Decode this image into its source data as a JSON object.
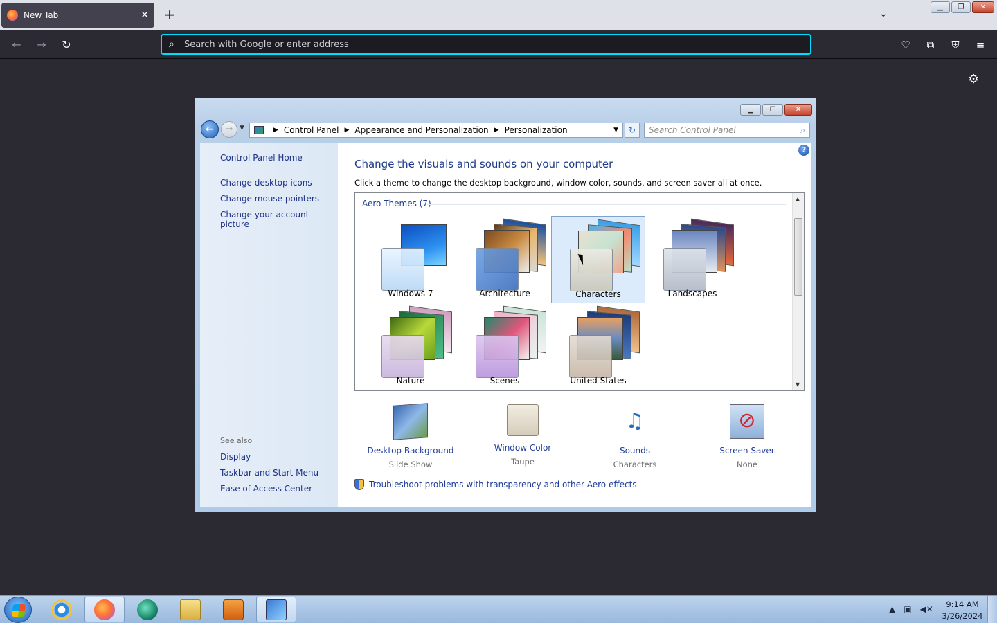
{
  "browser": {
    "tab_title": "New Tab",
    "url_placeholder": "Search with Google or enter address"
  },
  "control_panel": {
    "breadcrumb": [
      "Control Panel",
      "Appearance and Personalization",
      "Personalization"
    ],
    "search_placeholder": "Search Control Panel",
    "left_links": [
      "Control Panel Home",
      "Change desktop icons",
      "Change mouse pointers",
      "Change your account picture"
    ],
    "see_also_label": "See also",
    "see_also_links": [
      "Display",
      "Taskbar and Start Menu",
      "Ease of Access Center"
    ],
    "heading": "Change the visuals and sounds on your computer",
    "subtext": "Click a theme to change the desktop background, window color, sounds, and screen saver all at once.",
    "group_label": "Aero Themes (7)",
    "themes": [
      "Windows 7",
      "Architecture",
      "Characters",
      "Landscapes",
      "Nature",
      "Scenes",
      "United States"
    ],
    "selected_theme": "Characters",
    "bottom_items": [
      {
        "name": "Desktop Background",
        "value": "Slide Show"
      },
      {
        "name": "Window Color",
        "value": "Taupe"
      },
      {
        "name": "Sounds",
        "value": "Characters"
      },
      {
        "name": "Screen Saver",
        "value": "None"
      }
    ],
    "troubleshoot_link": "Troubleshoot problems with transparency and other Aero effects"
  },
  "taskbar": {
    "time": "9:14 AM",
    "date": "3/26/2024"
  }
}
